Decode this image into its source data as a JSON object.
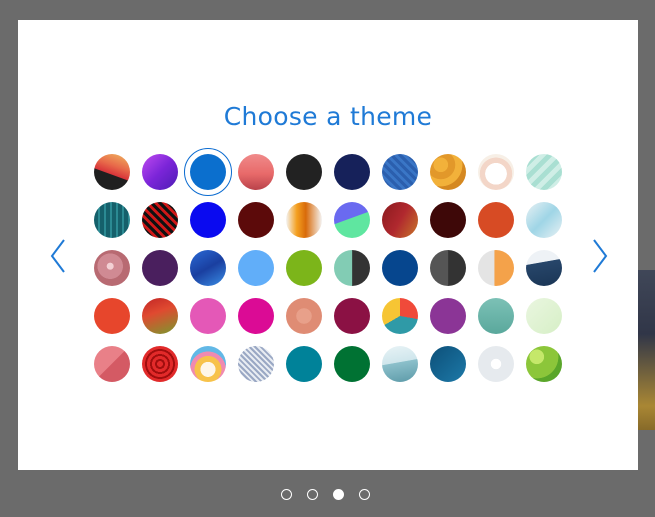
{
  "dialog": {
    "title": "Choose a theme"
  },
  "swatches": [
    {
      "name": "theme-swatch-1",
      "bg": "linear-gradient(200deg,#f0b860 0%,#e86a4a 35%,#d8343a 55%,#1f1f1f 56%,#1f1f1f 100%)"
    },
    {
      "name": "theme-swatch-2",
      "bg": "linear-gradient(135deg,#c04bf0 0%,#7b25d8 50%,#4c1cb4 100%)"
    },
    {
      "name": "theme-swatch-3",
      "bg": "#0b6fce",
      "selected": true
    },
    {
      "name": "theme-swatch-4",
      "bg": "linear-gradient(180deg,#f08a8a 0%,#e86a6a 55%,#b9424a 100%)"
    },
    {
      "name": "theme-swatch-5",
      "bg": "#222222"
    },
    {
      "name": "theme-swatch-6",
      "bg": "#16215a"
    },
    {
      "name": "theme-swatch-7",
      "bg": "repeating-linear-gradient(45deg,#2b5fae 0 3px,#3a76c6 3px 6px)"
    },
    {
      "name": "theme-swatch-8",
      "bg": "radial-gradient(circle at 30% 30%,#f2b13a 0 20%,#e2982a 21% 40%,#f2b13a 41% 60%,#d58820 61%)"
    },
    {
      "name": "theme-swatch-9",
      "bg": "radial-gradient(circle at 50% 55%,#ffffff 0 40%,#f3d6c8 41% 60%,#f7efe6 61%)"
    },
    {
      "name": "theme-swatch-10",
      "bg": "repeating-linear-gradient(135deg,#cfeee6 0 5px,#a9dfd2 5px 10px)"
    },
    {
      "name": "theme-swatch-11",
      "bg": "repeating-linear-gradient(90deg,#15606b 0 4px,#2b8a93 4px 6px)"
    },
    {
      "name": "theme-swatch-12",
      "bg": "repeating-linear-gradient(45deg,#111 0 3px,#d01818 3px 6px)"
    },
    {
      "name": "theme-swatch-13",
      "bg": "#0a0af0"
    },
    {
      "name": "theme-swatch-14",
      "bg": "#5c0a0a"
    },
    {
      "name": "theme-swatch-15",
      "bg": "linear-gradient(90deg,#f4f4f4 0%,#f4a020 30%,#d86a0a 55%,#f4f4f4 100%)"
    },
    {
      "name": "theme-swatch-16",
      "bg": "linear-gradient(160deg,#6a6af0 0%,#6a6af0 45%,#5fe6a0 46%,#5fe6a0 100%)"
    },
    {
      "name": "theme-swatch-17",
      "bg": "linear-gradient(120deg,#8a1a1e 0%,#b0282e 50%,#c8782a 100%)"
    },
    {
      "name": "theme-swatch-18",
      "bg": "#3e0808"
    },
    {
      "name": "theme-swatch-19",
      "bg": "#d74b24"
    },
    {
      "name": "theme-swatch-20",
      "bg": "linear-gradient(135deg,#e8f1f4 0%,#9fd5e6 50%,#e8f1f4 100%)"
    },
    {
      "name": "theme-swatch-21",
      "bg": "radial-gradient(circle at 45% 45%,#f3d0d4 0 12%,#d08a93 13% 45%,#b86a72 46%)"
    },
    {
      "name": "theme-swatch-22",
      "bg": "#4a1f5e"
    },
    {
      "name": "theme-swatch-23",
      "bg": "linear-gradient(150deg,#2a6ad6 0%,#1a3fa0 50%,#3a8ee6 100%)"
    },
    {
      "name": "theme-swatch-24",
      "bg": "#61aef9"
    },
    {
      "name": "theme-swatch-25",
      "bg": "#7cb51a"
    },
    {
      "name": "theme-swatch-26",
      "bg": "linear-gradient(90deg,#82ccb4 0%,#82ccb4 50%,#333333 51%,#333333 100%)"
    },
    {
      "name": "theme-swatch-27",
      "bg": "#06468e"
    },
    {
      "name": "theme-swatch-28",
      "bg": "linear-gradient(90deg,#555555 0%,#555555 50%,#333333 51%,#333333 100%)"
    },
    {
      "name": "theme-swatch-29",
      "bg": "linear-gradient(90deg,#e4e4e4 0%,#e4e4e4 45%,#f4a24a 46%,#f4a24a 100%)"
    },
    {
      "name": "theme-swatch-30",
      "bg": "linear-gradient(170deg,#eef2f6 0%,#eef2f6 35%,#27466a 36%,#1a3555 100%)"
    },
    {
      "name": "theme-swatch-31",
      "bg": "#e7462c"
    },
    {
      "name": "theme-swatch-32",
      "bg": "linear-gradient(160deg,#c22626 0%,#e04a30 40%,#7a9a2e 100%)"
    },
    {
      "name": "theme-swatch-33",
      "bg": "#e458b7"
    },
    {
      "name": "theme-swatch-34",
      "bg": "#db0b95"
    },
    {
      "name": "theme-swatch-35",
      "bg": "radial-gradient(circle at 50% 50%,#e8a08a 0 30%,#df8c74 31%)"
    },
    {
      "name": "theme-swatch-36",
      "bg": "#8b1144"
    },
    {
      "name": "theme-swatch-37",
      "bg": "conic-gradient(#f04a3a 0 100deg,#2f9aa7 100deg 240deg,#f6c534 240deg 360deg)"
    },
    {
      "name": "theme-swatch-38",
      "bg": "#8b3596"
    },
    {
      "name": "theme-swatch-39",
      "bg": "linear-gradient(180deg,#7cc1b6 0%,#5aa89c 100%)"
    },
    {
      "name": "theme-swatch-40",
      "bg": "linear-gradient(135deg,#eaf6e0 0%,#d6efc6 100%)"
    },
    {
      "name": "theme-swatch-41",
      "bg": "linear-gradient(135deg,#e98088 0%,#e98088 49%,#d45a64 50%,#d45a64 100%)"
    },
    {
      "name": "theme-swatch-42",
      "bg": "repeating-radial-gradient(circle at 50% 50%,#e22a2a 0 3px,#a10e0e 3px 5px)"
    },
    {
      "name": "theme-swatch-43",
      "bg": "radial-gradient(circle at 50% 65%,#fef6e8 0 25%,#f7c24a 26% 45%,#f08ab0 46% 60%,#62b8e6 61%)"
    },
    {
      "name": "theme-swatch-44",
      "bg": "repeating-linear-gradient(45deg,#9aa8c4 0 2px,#e8ecf2 2px 4px)"
    },
    {
      "name": "theme-swatch-45",
      "bg": "#008299"
    },
    {
      "name": "theme-swatch-46",
      "bg": "#007233"
    },
    {
      "name": "theme-swatch-47",
      "bg": "linear-gradient(170deg,#e8f3f6 0%,#cfe6ec 45%,#8cc0cb 46%,#5c9aa8 100%)"
    },
    {
      "name": "theme-swatch-48",
      "bg": "linear-gradient(135deg,#0c4f78 0%,#1d79a8 100%)"
    },
    {
      "name": "theme-swatch-49",
      "bg": "radial-gradient(circle at 50% 50%,#ffffff 0 20%,#e6eaee 21%)"
    },
    {
      "name": "theme-swatch-50",
      "bg": "radial-gradient(circle at 30% 30%,#c5e86a 0 20%,#8cc63a 21% 60%,#5aa62a 61%)"
    }
  ],
  "pager": {
    "count": 4,
    "active_index": 2
  }
}
